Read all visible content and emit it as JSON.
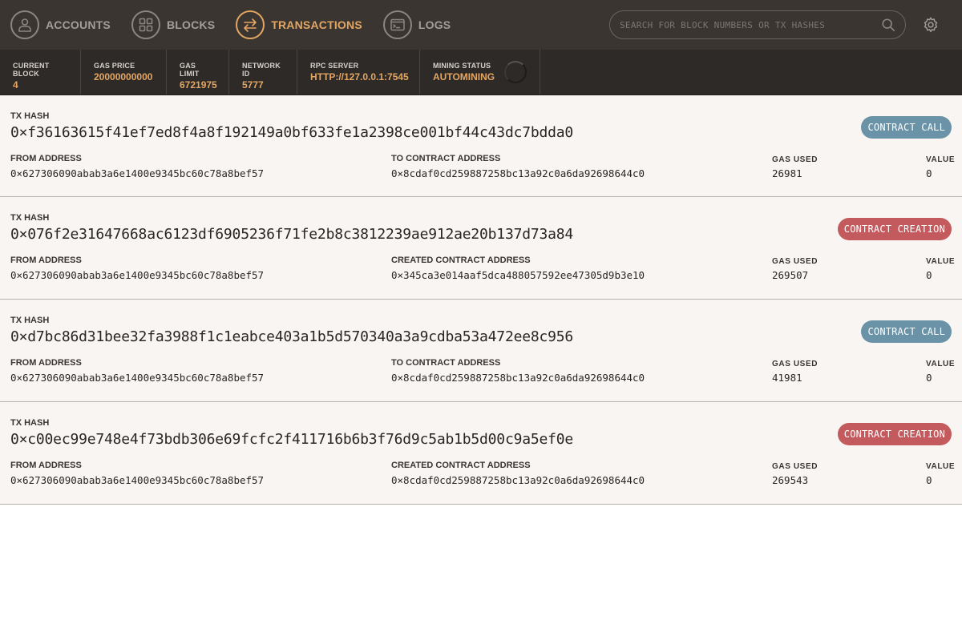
{
  "nav": {
    "items": [
      {
        "label": "ACCOUNTS",
        "icon": "account-icon",
        "active": false
      },
      {
        "label": "BLOCKS",
        "icon": "blocks-icon",
        "active": false
      },
      {
        "label": "TRANSACTIONS",
        "icon": "transactions-icon",
        "active": true
      },
      {
        "label": "LOGS",
        "icon": "logs-icon",
        "active": false
      }
    ],
    "search_placeholder": "SEARCH FOR BLOCK NUMBERS OR TX HASHES"
  },
  "status": {
    "current_block": {
      "label": "CURRENT BLOCK",
      "value": "4"
    },
    "gas_price": {
      "label": "GAS PRICE",
      "value": "20000000000"
    },
    "gas_limit": {
      "label": "GAS LIMIT",
      "value": "6721975"
    },
    "network_id": {
      "label": "NETWORK ID",
      "value": "5777"
    },
    "rpc_server": {
      "label": "RPC SERVER",
      "value": "HTTP://127.0.0.1:7545"
    },
    "mining_status": {
      "label": "MINING STATUS",
      "value": "AUTOMINING"
    }
  },
  "labels": {
    "tx_hash": "TX HASH",
    "from_address": "FROM ADDRESS",
    "gas_used": "GAS USED",
    "value": "VALUE"
  },
  "colors": {
    "accent": "#e4a663",
    "contract_call": "#6a93a8",
    "contract_creation": "#c25a5e"
  },
  "transactions": [
    {
      "hash": "0×f36163615f41ef7ed8f4a8f192149a0bf633fe1a2398ce001bf44c43dc7bdda0",
      "type": "CONTRACT CALL",
      "from": "0×627306090abab3a6e1400e9345bc60c78a8bef57",
      "to_label": "TO CONTRACT ADDRESS",
      "to": "0×8cdaf0cd259887258bc13a92c0a6da92698644c0",
      "gas_used": "26981",
      "value": "0"
    },
    {
      "hash": "0×076f2e31647668ac6123df6905236f71fe2b8c3812239ae912ae20b137d73a84",
      "type": "CONTRACT CREATION",
      "from": "0×627306090abab3a6e1400e9345bc60c78a8bef57",
      "to_label": "CREATED CONTRACT ADDRESS",
      "to": "0×345ca3e014aaf5dca488057592ee47305d9b3e10",
      "gas_used": "269507",
      "value": "0"
    },
    {
      "hash": "0×d7bc86d31bee32fa3988f1c1eabce403a1b5d570340a3a9cdba53a472ee8c956",
      "type": "CONTRACT CALL",
      "from": "0×627306090abab3a6e1400e9345bc60c78a8bef57",
      "to_label": "TO CONTRACT ADDRESS",
      "to": "0×8cdaf0cd259887258bc13a92c0a6da92698644c0",
      "gas_used": "41981",
      "value": "0"
    },
    {
      "hash": "0×c00ec99e748e4f73bdb306e69fcfc2f411716b6b3f76d9c5ab1b5d00c9a5ef0e",
      "type": "CONTRACT CREATION",
      "from": "0×627306090abab3a6e1400e9345bc60c78a8bef57",
      "to_label": "CREATED CONTRACT ADDRESS",
      "to": "0×8cdaf0cd259887258bc13a92c0a6da92698644c0",
      "gas_used": "269543",
      "value": "0"
    }
  ]
}
